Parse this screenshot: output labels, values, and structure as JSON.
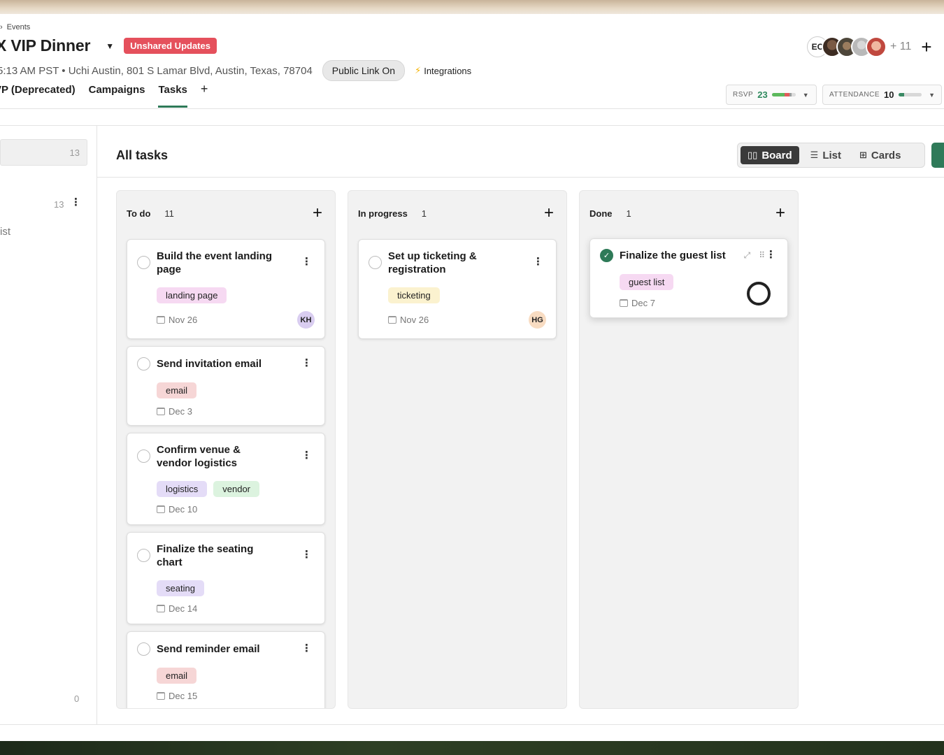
{
  "breadcrumb": {
    "chevron": "›",
    "label": "Events"
  },
  "header": {
    "title": "X VIP Dinner",
    "unshared_badge": "Unshared Updates",
    "meta": "5:13 AM PST • Uchi Austin, 801 S Lamar Blvd, Austin, Texas, 78704",
    "public_link": "Public Link On",
    "integrations": "Integrations",
    "integrations_icon": "lightning-icon"
  },
  "tabs": [
    {
      "label": "VP (Deprecated)"
    },
    {
      "label": "Campaigns"
    },
    {
      "label": "Tasks",
      "active": true
    }
  ],
  "tab_add": "+",
  "collaborators": {
    "initials": "EC",
    "more": "+ 11",
    "add": "+"
  },
  "rsvp": {
    "label": "RSVP",
    "count": "23",
    "segments": [
      {
        "color": "#5cb85c",
        "pct": 55
      },
      {
        "color": "#e05a5a",
        "pct": 18
      },
      {
        "color": "#9b9b9b",
        "pct": 10
      },
      {
        "color": "#dddddd",
        "pct": 17
      }
    ]
  },
  "attendance": {
    "label": "ATTENDANCE",
    "count": "10",
    "segments": [
      {
        "color": "#3a8a64",
        "pct": 25
      },
      {
        "color": "#d8d8d8",
        "pct": 75
      }
    ]
  },
  "sidebar": {
    "selected_count": "13",
    "count": "13",
    "item_text": "ist",
    "footer_count": "0"
  },
  "main": {
    "title": "All tasks",
    "views": [
      {
        "label": "Board",
        "icon": "board-icon",
        "active": true
      },
      {
        "label": "List",
        "icon": "list-icon"
      },
      {
        "label": "Cards",
        "icon": "cards-icon"
      }
    ]
  },
  "columns": [
    {
      "name": "To do",
      "count": "11",
      "cards": [
        {
          "title": "Build the event landing page",
          "tags": [
            {
              "label": "landing page",
              "color": "#f6d9f2"
            }
          ],
          "date": "Nov 26",
          "assignee": "KH",
          "assignee_color": "#d9cdf0"
        },
        {
          "title": "Send invitation email",
          "tags": [
            {
              "label": "email",
              "color": "#f6d6d6"
            }
          ],
          "date": "Dec 3"
        },
        {
          "title": "Confirm venue & vendor logistics",
          "tags": [
            {
              "label": "logistics",
              "color": "#e4dcf7"
            },
            {
              "label": "vendor",
              "color": "#dcf3df"
            }
          ],
          "date": "Dec 10"
        },
        {
          "title": "Finalize the seating chart",
          "tags": [
            {
              "label": "seating",
              "color": "#e4dcf7"
            }
          ],
          "date": "Dec 14"
        },
        {
          "title": "Send reminder email",
          "tags": [
            {
              "label": "email",
              "color": "#f6d6d6"
            }
          ],
          "date": "Dec 15"
        }
      ]
    },
    {
      "name": "In progress",
      "count": "1",
      "cards": [
        {
          "title": "Set up ticketing & registration",
          "tags": [
            {
              "label": "ticketing",
              "color": "#fbf2cf"
            }
          ],
          "date": "Nov 26",
          "assignee": "HG",
          "assignee_color": "#f8dcc2"
        }
      ]
    },
    {
      "name": "Done",
      "count": "1",
      "cards": [
        {
          "title": "Finalize the guest list",
          "tags": [
            {
              "label": "guest list",
              "color": "#f6d9f2"
            }
          ],
          "date": "Dec 7",
          "done": true
        }
      ]
    }
  ]
}
